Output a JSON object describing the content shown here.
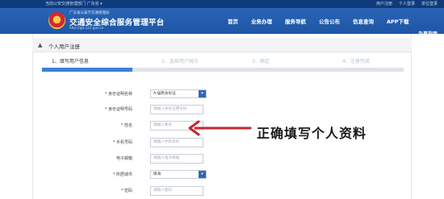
{
  "topbar": {
    "left_text": "当前公安交通管理部门  广东省 ▾",
    "links": [
      "用户注册",
      "个人登录",
      "单位登录"
    ]
  },
  "header": {
    "subtitle": "广东省公安厅交通管理局",
    "title": "交通安全综合服务管理平台",
    "url": "http://gd.122.gov.cn",
    "nav": [
      "首页",
      "业务办理",
      "服务导航",
      "公告公布",
      "信息查询",
      "APP下载"
    ],
    "nav_sub": "办事指南"
  },
  "page": {
    "title": "个人用户注册"
  },
  "steps": [
    {
      "label": "1、填写用户信息",
      "active": true
    },
    {
      "label": "2、选择用户网点",
      "active": false
    },
    {
      "label": "3、确定",
      "active": false
    },
    {
      "label": "4、注册完成",
      "active": false
    }
  ],
  "form": {
    "id_type_label": "* 身份证明名称",
    "id_type_value": "A:居民身份证",
    "id_number_label": "* 身份证明号码",
    "id_number_placeholder": "请输入身份证明号码",
    "name_label": "* 姓名",
    "name_placeholder": "请输入姓名",
    "phone_label": "* 手机号码",
    "phone_placeholder": "请输入手机号码",
    "email_label": "电子邮箱",
    "email_placeholder": "请输入电子邮箱",
    "city_label": "* 所居城市",
    "city_value": "珠海",
    "password_label": "* 密码",
    "password_placeholder": "请输入密码"
  },
  "annotation": {
    "text": "正确填写个人资料",
    "color": "#c0282d"
  },
  "colors": {
    "topbar": "#0f3b7c",
    "header": "#1e56a5",
    "step_active": "#3d7fd4",
    "select_caret": "#2e66b7"
  }
}
